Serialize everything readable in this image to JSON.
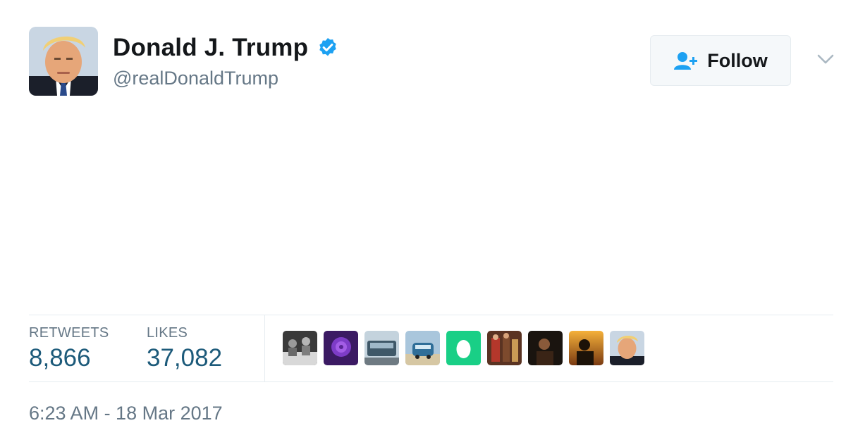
{
  "tweet": {
    "author": {
      "name": "Donald J. Trump",
      "handle": "@realDonaldTrump",
      "verified": true
    },
    "follow_button": {
      "label": "Follow",
      "icon": "add-user-icon"
    },
    "menu_icon": "chevron-down-icon",
    "stats": {
      "retweets": {
        "label": "RETWEETS",
        "value": "8,866"
      },
      "likes": {
        "label": "LIKES",
        "value": "37,082"
      }
    },
    "likers": [
      "liker-avatar-bw-group",
      "liker-avatar-purple-rose",
      "liker-avatar-vehicle",
      "liker-avatar-blue-van",
      "liker-avatar-default-egg",
      "liker-avatar-painting",
      "liker-avatar-dark-portrait",
      "liker-avatar-sunset-silhouette",
      "liker-avatar-portrait"
    ],
    "timestamp": "6:23 AM - 18 Mar 2017"
  },
  "colors": {
    "stat_value": "#1c5a7a",
    "muted_text": "#657786",
    "verified_badge": "#1da1f2",
    "follow_icon": "#1da1f2",
    "divider": "#e6ecf0",
    "egg_avatar": "#19cf86"
  }
}
